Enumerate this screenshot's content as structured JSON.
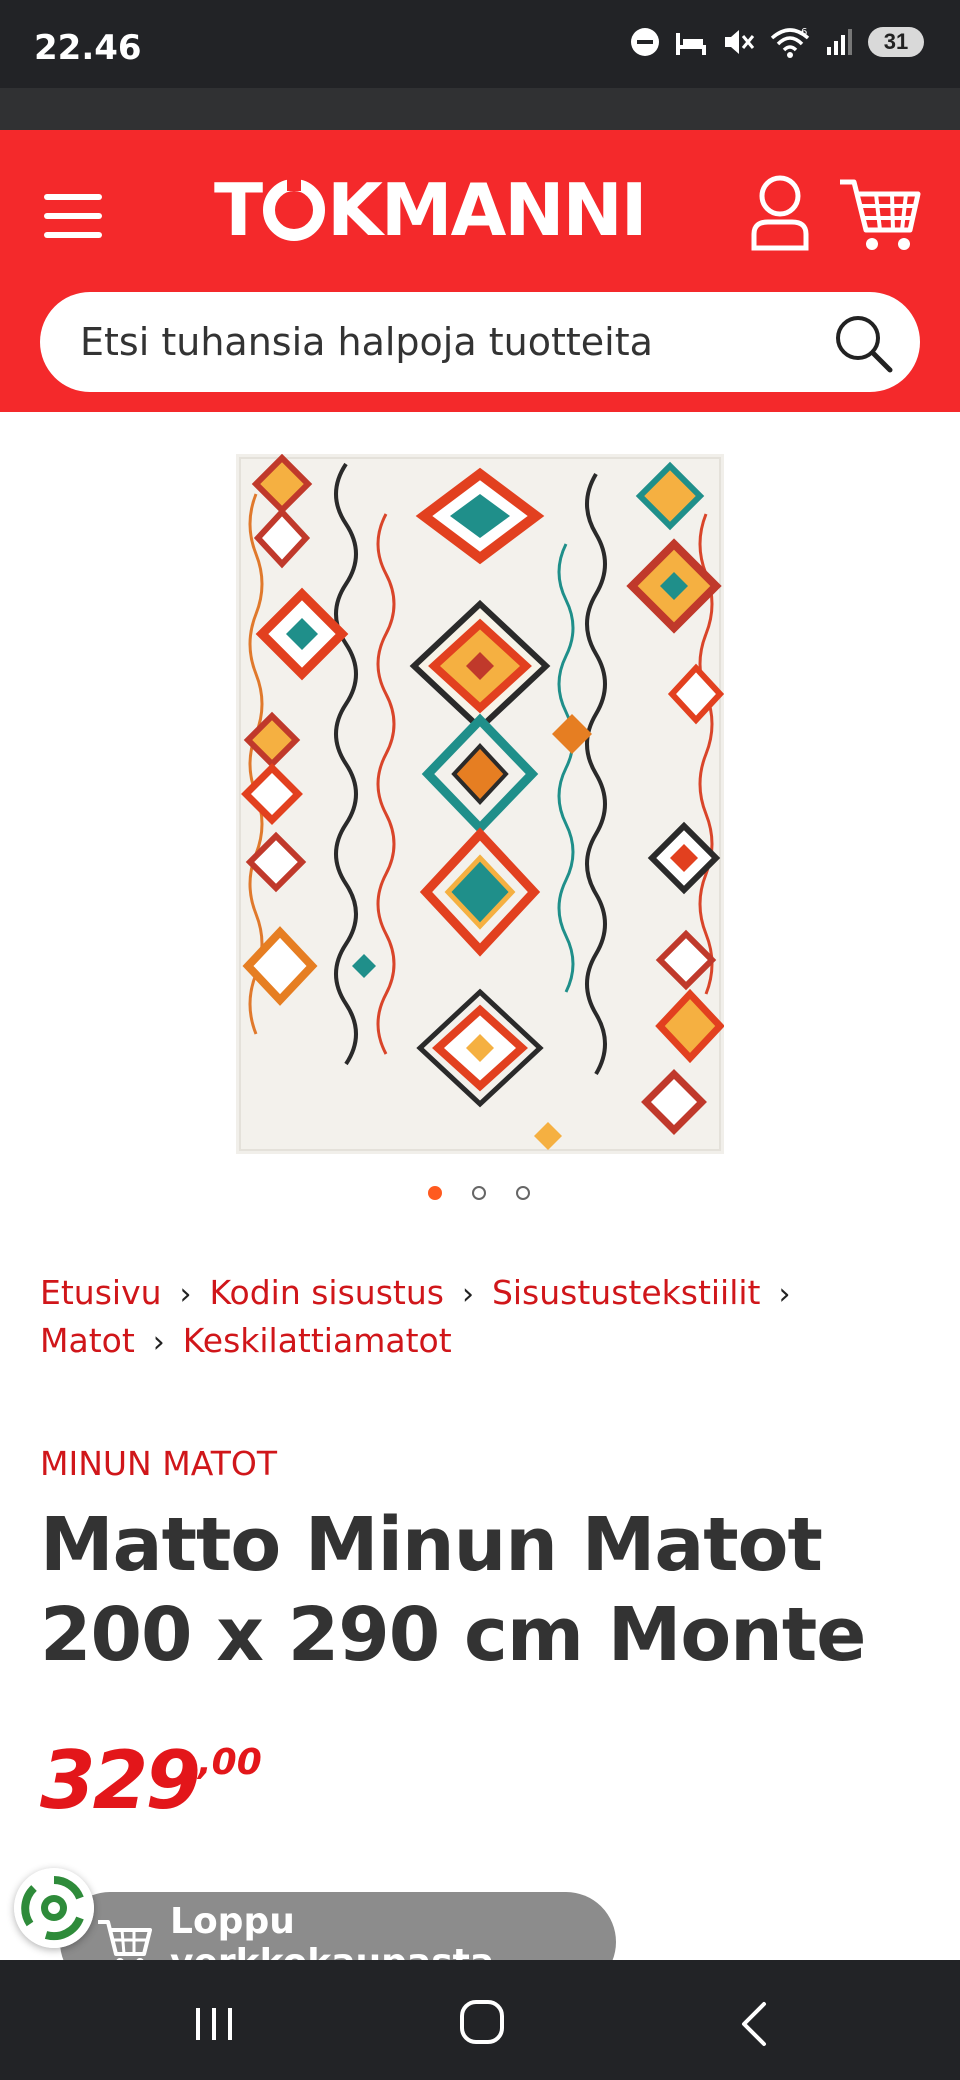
{
  "status": {
    "time": "22.46",
    "battery": "31",
    "signal_badge": "6",
    "icons": [
      "do-not-disturb-icon",
      "sleep-mode-icon",
      "mute-icon",
      "wifi-icon",
      "cellular-signal-icon",
      "battery-icon"
    ]
  },
  "header": {
    "brand_logo": "TOKMANNI",
    "logo_prefix": "T",
    "logo_suffix": "KMANNI",
    "accent_color": "#f4292b",
    "icons": [
      "hamburger-menu-icon",
      "user-icon",
      "cart-icon"
    ]
  },
  "search": {
    "placeholder": "Etsi tuhansia halpoja tuotteita",
    "icon": "search-icon"
  },
  "gallery": {
    "image_count": 3,
    "active_index": 0,
    "active_color": "#ff5a1f"
  },
  "breadcrumb": [
    {
      "label": "Etusivu"
    },
    {
      "label": "Kodin sisustus"
    },
    {
      "label": "Sisustustekstiilit"
    },
    {
      "label": "Matot"
    },
    {
      "label": "Keskilattiamatot"
    }
  ],
  "product": {
    "brand": "MINUN MATOT",
    "title": "Matto Minun Matot 200 x 290 cm Monte",
    "price_int": "329",
    "price_dec": ",00",
    "price_color": "#e3161a"
  },
  "actions": {
    "soldout_label": "Loppu verkkokaupasta"
  },
  "navbar": {
    "icons": [
      "recent-apps-icon",
      "home-icon",
      "back-icon"
    ]
  }
}
